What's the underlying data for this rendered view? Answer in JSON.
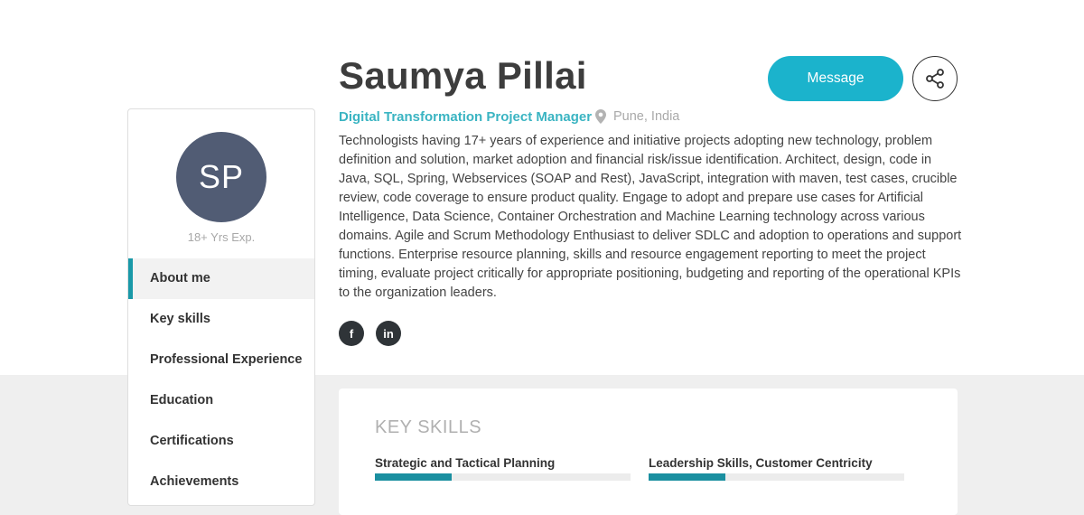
{
  "profile": {
    "initials": "SP",
    "experience": "18+ Yrs Exp.",
    "name": "Saumya Pillai",
    "role": "Digital Transformation Project Manager",
    "location": "Pune, India",
    "about": "Technologists having 17+ years of experience and initiative projects adopting new technology, problem definition and solution, market adoption and financial risk/issue identification. Architect, design, code in Java, SQL, Spring, Webservices (SOAP and Rest), JavaScript, integration with maven, test cases, crucible review, code coverage to ensure product quality. Engage to adopt and prepare use cases for Artificial Intelligence, Data Science, Container Orchestration and Machine Learning technology across various domains. Agile and Scrum Methodology Enthusiast to deliver SDLC and adoption to operations and support functions. Enterprise resource planning, skills and resource engagement reporting to meet the project timing, evaluate project critically for appropriate positioning, budgeting and reporting of the operational KPIs to the organization leaders."
  },
  "actions": {
    "message_label": "Message",
    "share_icon": "share-icon"
  },
  "social": {
    "facebook": "f",
    "linkedin": "in"
  },
  "nav": {
    "items": [
      {
        "label": "About me",
        "active": true
      },
      {
        "label": "Key skills"
      },
      {
        "label": "Professional Experience"
      },
      {
        "label": "Education"
      },
      {
        "label": "Certifications"
      },
      {
        "label": "Achievements"
      }
    ]
  },
  "skills": {
    "title": "KEY SKILLS",
    "items": [
      {
        "label": "Strategic and Tactical Planning",
        "level": 0.3
      },
      {
        "label": "Leadership Skills, Customer Centricity",
        "level": 0.3
      }
    ]
  },
  "colors": {
    "accent": "#1bb3cc",
    "role_text": "#3ab4c2",
    "avatar_bg": "#515c74",
    "skill_fill": "#1a8fa0"
  }
}
